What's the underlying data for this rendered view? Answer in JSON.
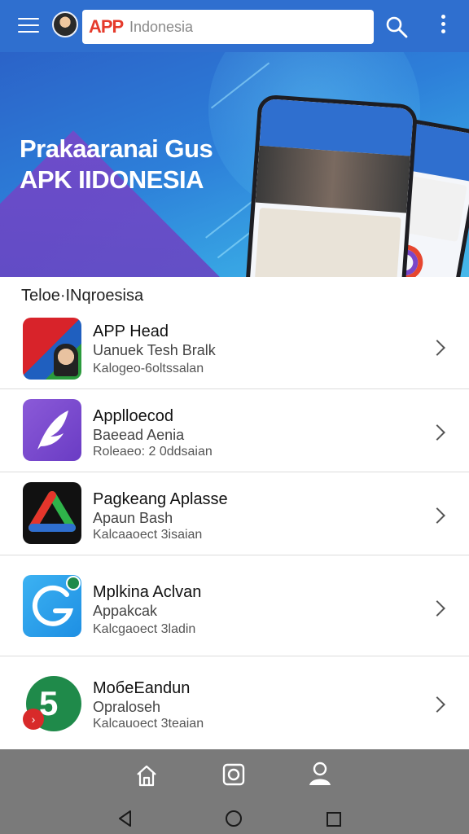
{
  "header": {
    "logo": {
      "brand": "APP",
      "tagline": ""
    },
    "search": {
      "placeholder": "Indonesia"
    },
    "icons": [
      "hamburger-menu-icon",
      "search-icon",
      "more-vertical-icon"
    ]
  },
  "banner": {
    "title_line1": "Prakaaranai Gus",
    "title_line2": "APK IIDONESIA"
  },
  "section": {
    "title": "Teloe·INqroesisa"
  },
  "apps": [
    {
      "title": "APP Head",
      "subtitle": "Uanuek Tesh Bralk",
      "meta": "Kalogeo-6oltssalan",
      "icon": "collage-icon"
    },
    {
      "title": "Applloecod",
      "subtitle": "Baeead Aenia",
      "meta": "Roleaeo: 2 0ddsaian",
      "icon": "feather-icon"
    },
    {
      "title": "Pagkeang Aplasse",
      "subtitle": "Apaun Bash",
      "meta": "Kalcaaoect 3isaian",
      "icon": "triangle-logo-icon"
    },
    {
      "title": "Mplkina Aclvan",
      "subtitle": "Appakcak",
      "meta": "Kalcgaoect 3ladin",
      "icon": "phone-g-icon"
    },
    {
      "title": "MoбeEandun",
      "subtitle": "Opraloseh",
      "meta": "Kalcauoect 3teaian",
      "icon": "five-icon"
    }
  ],
  "bottom_nav": [
    "home-icon",
    "media-icon",
    "profile-icon"
  ],
  "system_nav": [
    "back-icon",
    "home-circle-icon",
    "recent-apps-icon"
  ],
  "colors": {
    "topbar": "#2f6fcf",
    "bottom_nav": "#7a7a7a"
  }
}
